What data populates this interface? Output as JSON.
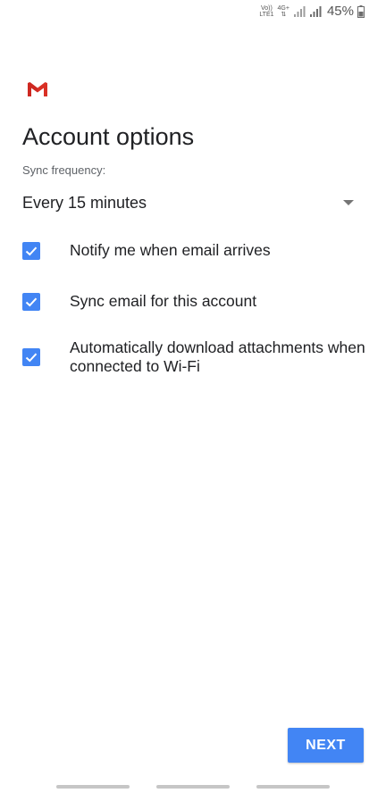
{
  "status_bar": {
    "network_top": "Vo)) LTE1",
    "network_line1": "Vo))",
    "network_line2": "LTE1",
    "data_line1": "4G+",
    "data_line2": "⇅",
    "battery_percent": "45%"
  },
  "app": {
    "logo_icon": "gmail-icon",
    "logo_color": "#d93025"
  },
  "page": {
    "title": "Account options"
  },
  "sync": {
    "label": "Sync frequency:",
    "selected_value": "Every 15 minutes"
  },
  "options": [
    {
      "label": "Notify me when email arrives",
      "checked": true
    },
    {
      "label": "Sync email for this account",
      "checked": true
    },
    {
      "label": "Automatically download attachments when connected to Wi-Fi",
      "checked": true
    }
  ],
  "actions": {
    "next_label": "NEXT"
  },
  "colors": {
    "accent": "#4285f4",
    "text_primary": "#202124",
    "text_secondary": "#5f6368"
  }
}
